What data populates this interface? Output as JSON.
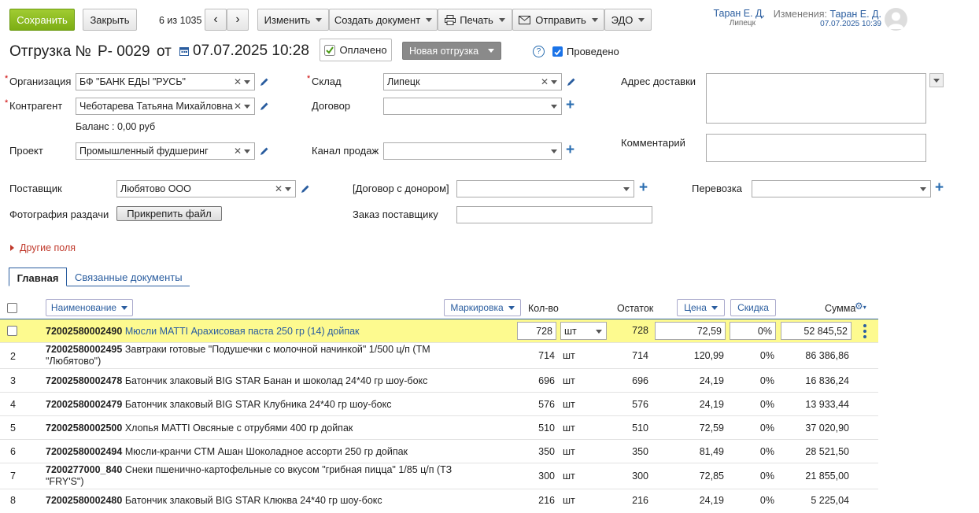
{
  "toolbar": {
    "save": "Сохранить",
    "close": "Закрыть",
    "counter": "6 из 1035",
    "edit": "Изменить",
    "create_doc": "Создать документ",
    "print": "Печать",
    "send": "Отправить",
    "edo": "ЭДО"
  },
  "user": {
    "name": "Таран Е. Д.",
    "city": "Липецк",
    "changes_label": "Изменения:",
    "changes_user": "Таран Е. Д.",
    "changes_date": "07.07.2025 10:39"
  },
  "title": {
    "doc": "Отгрузка №",
    "number": "Р- 0029",
    "from": "от",
    "datetime": "07.07.2025 10:28",
    "paid": "Оплачено",
    "status": "Новая отгрузка",
    "help": "?",
    "posted": "Проведено"
  },
  "form": {
    "org_label": "Организация",
    "org_value": "БФ \"БАНК ЕДЫ \"РУСЬ\"",
    "contractor_label": "Контрагент",
    "contractor_value": "Чеботарева Татьяна Михайловна",
    "balance": "Баланс : 0,00 руб",
    "project_label": "Проект",
    "project_value": "Промышленный фудшеринг",
    "warehouse_label": "Склад",
    "warehouse_value": "Липецк",
    "contract_label": "Договор",
    "channel_label": "Канал продаж",
    "address_label": "Адрес доставки",
    "comment_label": "Комментарий",
    "supplier_label": "Поставщик",
    "supplier_value": "Любятово ООО",
    "donor_label": "[Договор с донором]",
    "transport_label": "Перевозка",
    "photo_label": "Фотография раздачи",
    "attach": "Прикрепить файл",
    "supplier_order_label": "Заказ поставщику",
    "other_fields": "Другие поля"
  },
  "tabs": [
    "Главная",
    "Связанные документы"
  ],
  "table": {
    "headers": {
      "name": "Наименование",
      "marking": "Маркировка",
      "qty": "Кол-во",
      "stock": "Остаток",
      "price": "Цена",
      "discount": "Скидка",
      "sum": "Сумма"
    },
    "rows": [
      {
        "n": "",
        "code": "72002580002490",
        "name": "Мюсли МАТТI Арахисовая паста 250 гр (14) дойпак",
        "qty": "728",
        "unit": "шт",
        "stock": "728",
        "price": "72,59",
        "disc": "0%",
        "sum": "52 845,52"
      },
      {
        "n": "2",
        "code": "72002580002495",
        "name": "Завтраки готовые \"Подушечки с молочной начинкой\" 1/500 ц/п (ТМ",
        "name2": "\"Любятово\")",
        "qty": "714",
        "unit": "шт",
        "stock": "714",
        "price": "120,99",
        "disc": "0%",
        "sum": "86 386,86"
      },
      {
        "n": "3",
        "code": "72002580002478",
        "name": "Батончик злаковый BIG STAR Банан и шоколад 24*40 гр шоу-бокс",
        "qty": "696",
        "unit": "шт",
        "stock": "696",
        "price": "24,19",
        "disc": "0%",
        "sum": "16 836,24"
      },
      {
        "n": "4",
        "code": "72002580002479",
        "name": "Батончик злаковый BIG STAR Клубника 24*40 гр шоу-бокс",
        "qty": "576",
        "unit": "шт",
        "stock": "576",
        "price": "24,19",
        "disc": "0%",
        "sum": "13 933,44"
      },
      {
        "n": "5",
        "code": "72002580002500",
        "name": "Хлопья МАТТI Овсяные с отрубями 400 гр дойпак",
        "qty": "510",
        "unit": "шт",
        "stock": "510",
        "price": "72,59",
        "disc": "0%",
        "sum": "37 020,90"
      },
      {
        "n": "6",
        "code": "72002580002494",
        "name": "Мюсли-кранчи СТМ Ашан Шоколадное ассорти 250 гр дойпак",
        "qty": "350",
        "unit": "шт",
        "stock": "350",
        "price": "81,49",
        "disc": "0%",
        "sum": "28 521,50"
      },
      {
        "n": "7",
        "code": "7200277000_840",
        "name": "Снеки пшенично-картофельные со вкусом \"грибная пицца\" 1/85 ц/п (ТЗ",
        "name2": "\"FRY'S\")",
        "qty": "300",
        "unit": "шт",
        "stock": "300",
        "price": "72,85",
        "disc": "0%",
        "sum": "21 855,00"
      },
      {
        "n": "8",
        "code": "72002580002480",
        "name": "Батончик злаковый BIG STAR Клюква 24*40 гр шоу-бокс",
        "qty": "216",
        "unit": "шт",
        "stock": "216",
        "price": "24,19",
        "disc": "0%",
        "sum": "5 225,04"
      }
    ]
  },
  "colors": {
    "save_green": "#8fc01c",
    "highlight": "#fdfa8f",
    "link": "#2a5d9f",
    "status_gray": "#888888"
  }
}
